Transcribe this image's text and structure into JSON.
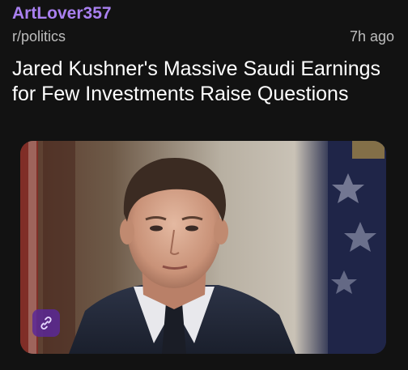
{
  "post": {
    "author": "ArtLover357",
    "subreddit": "r/politics",
    "time_ago": "7h ago",
    "title": "Jared Kushner's Massive Saudi Earnings for Few Investments Raise Questions"
  },
  "media": {
    "link_icon": "link-icon"
  },
  "colors": {
    "background": "#121212",
    "author": "#a980f0",
    "meta_text": "#bdbdbd",
    "title_text": "#ffffff",
    "link_badge": "#5a2896"
  }
}
